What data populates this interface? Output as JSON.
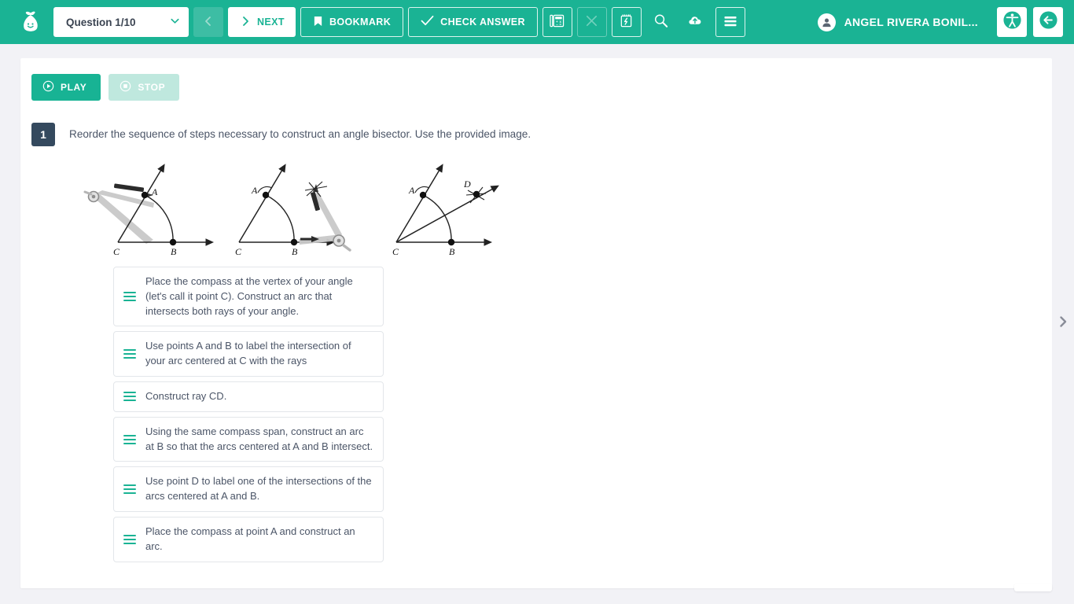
{
  "theme": {
    "brand": "#1ab394",
    "brand_dark": "#18b394",
    "page_bg": "#f2f2f6",
    "ink": "#4b5567",
    "badge_bg": "#34495e"
  },
  "header": {
    "logo_icon": "money-bag-smiley-logo",
    "question_select": {
      "value": "Question 1/10",
      "caret_icon": "chevron-down-icon"
    },
    "prev_button": {
      "label": "",
      "icon": "chevron-left-icon",
      "disabled": true
    },
    "next_button": {
      "label": "NEXT",
      "icon": "chevron-right-icon"
    },
    "bookmark_button": {
      "label": "BOOKMARK",
      "icon": "bookmark-icon"
    },
    "check_answer_button": {
      "label": "CHECK ANSWER",
      "icon": "check-icon"
    },
    "tools": [
      {
        "name": "calculator-icon",
        "disabled": false
      },
      {
        "name": "close-icon",
        "disabled": true
      },
      {
        "name": "scratchpad-icon",
        "disabled": false
      },
      {
        "name": "magnifier-icon",
        "disabled": false
      },
      {
        "name": "cloud-upload-icon",
        "disabled": false
      },
      {
        "name": "menu-lines-icon",
        "disabled": false
      }
    ],
    "user": {
      "name": "ANGEL RIVERA BONIL...",
      "avatar_icon": "user-icon"
    },
    "accessibility_button": {
      "icon": "accessibility-icon"
    },
    "logout_button": {
      "icon": "logout-icon"
    }
  },
  "main": {
    "play_button": {
      "label": "PLAY",
      "icon": "play-circle-icon"
    },
    "stop_button": {
      "label": "STOP",
      "icon": "stop-circle-icon",
      "disabled": true
    },
    "question": {
      "number": "1",
      "prompt": "Reorder the sequence of steps necessary to construct an angle bisector.  Use the provided image."
    },
    "figure": {
      "alt": "Three-panel compass-and-straightedge construction of an angle bisector",
      "panels": [
        {
          "labels": [
            "A",
            "B",
            "C"
          ],
          "caption": "compass at vertex C drawing arc through both rays"
        },
        {
          "labels": [
            "A",
            "B",
            "C"
          ],
          "caption": "compass at B drawing intersecting arc"
        },
        {
          "labels": [
            "A",
            "B",
            "C",
            "D"
          ],
          "caption": "ray CD drawn through intersection point D"
        }
      ]
    },
    "steps": [
      {
        "id": 1,
        "text": "Place the compass at the vertex of your angle (let's call it point C).  Construct an arc that intersects both rays of your angle.",
        "handle_icon": "drag-handle-icon"
      },
      {
        "id": 2,
        "text": "Use points A and B to label the intersection of your arc centered at C with the rays",
        "handle_icon": "drag-handle-icon"
      },
      {
        "id": 3,
        "text": "Construct ray CD.",
        "handle_icon": "drag-handle-icon"
      },
      {
        "id": 4,
        "text": "Using the same compass span, construct an arc at B so that the arcs centered at A and B intersect.",
        "handle_icon": "drag-handle-icon"
      },
      {
        "id": 5,
        "text": "Use point D to label one of the intersections of the arcs centered at A and B.",
        "handle_icon": "drag-handle-icon"
      },
      {
        "id": 6,
        "text": "Place the compass at point A and construct an arc.",
        "handle_icon": "drag-handle-icon"
      }
    ]
  },
  "side_panel_toggle": {
    "icon": "chevron-right-icon"
  }
}
